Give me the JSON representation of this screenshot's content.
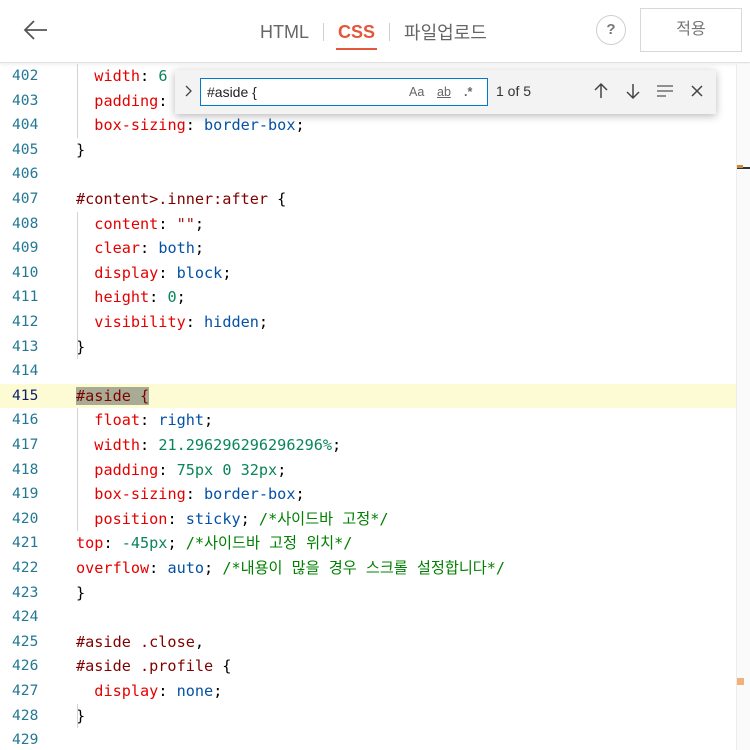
{
  "header": {
    "back_icon": "arrow-left-icon",
    "tabs": [
      {
        "label": "HTML",
        "active": false
      },
      {
        "label": "CSS",
        "active": true
      },
      {
        "label": "파일업로드",
        "active": false
      }
    ],
    "help_label": "?",
    "apply_label": "적용"
  },
  "find": {
    "toggle_icon": "chevron-right-icon",
    "query": "#aside {",
    "match_case_label": "Aa",
    "whole_word_label": "ab",
    "regex_label": ".*",
    "count": "1 of 5",
    "prev_icon": "arrow-up-icon",
    "next_icon": "arrow-down-icon",
    "in_selection_icon": "find-in-selection-icon",
    "close_icon": "close-icon"
  },
  "editor": {
    "current_line": "415",
    "lines": [
      {
        "num": "402",
        "tokens": [
          [
            "  ",
            "pun"
          ],
          [
            "width",
            "prop"
          ],
          [
            ": ",
            "pun"
          ],
          [
            "6",
            "num"
          ]
        ]
      },
      {
        "num": "403",
        "tokens": [
          [
            "  ",
            "pun"
          ],
          [
            "padding",
            "prop"
          ],
          [
            ":",
            "pun"
          ]
        ]
      },
      {
        "num": "404",
        "tokens": [
          [
            "  ",
            "pun"
          ],
          [
            "box-sizing",
            "prop"
          ],
          [
            ": ",
            "pun"
          ],
          [
            "border-box",
            "val"
          ],
          [
            ";",
            "pun"
          ]
        ]
      },
      {
        "num": "405",
        "tokens": [
          [
            "}",
            "pun"
          ]
        ]
      },
      {
        "num": "406",
        "tokens": []
      },
      {
        "num": "407",
        "tokens": [
          [
            "#content>.inner:after",
            "sel"
          ],
          [
            " {",
            "pun"
          ]
        ]
      },
      {
        "num": "408",
        "tokens": [
          [
            "  ",
            "pun"
          ],
          [
            "content",
            "prop"
          ],
          [
            ": ",
            "pun"
          ],
          [
            "\"\"",
            "str"
          ],
          [
            ";",
            "pun"
          ]
        ]
      },
      {
        "num": "409",
        "tokens": [
          [
            "  ",
            "pun"
          ],
          [
            "clear",
            "prop"
          ],
          [
            ": ",
            "pun"
          ],
          [
            "both",
            "val"
          ],
          [
            ";",
            "pun"
          ]
        ]
      },
      {
        "num": "410",
        "tokens": [
          [
            "  ",
            "pun"
          ],
          [
            "display",
            "prop"
          ],
          [
            ": ",
            "pun"
          ],
          [
            "block",
            "val"
          ],
          [
            ";",
            "pun"
          ]
        ]
      },
      {
        "num": "411",
        "tokens": [
          [
            "  ",
            "pun"
          ],
          [
            "height",
            "prop"
          ],
          [
            ": ",
            "pun"
          ],
          [
            "0",
            "num"
          ],
          [
            ";",
            "pun"
          ]
        ]
      },
      {
        "num": "412",
        "tokens": [
          [
            "  ",
            "pun"
          ],
          [
            "visibility",
            "prop"
          ],
          [
            ": ",
            "pun"
          ],
          [
            "hidden",
            "val"
          ],
          [
            ";",
            "pun"
          ]
        ]
      },
      {
        "num": "413",
        "tokens": [
          [
            "}",
            "pun"
          ]
        ]
      },
      {
        "num": "414",
        "tokens": []
      },
      {
        "num": "415",
        "tokens": [
          [
            "#aside {",
            "match"
          ]
        ]
      },
      {
        "num": "416",
        "tokens": [
          [
            "  ",
            "pun"
          ],
          [
            "float",
            "prop"
          ],
          [
            ": ",
            "pun"
          ],
          [
            "right",
            "val"
          ],
          [
            ";",
            "pun"
          ]
        ]
      },
      {
        "num": "417",
        "tokens": [
          [
            "  ",
            "pun"
          ],
          [
            "width",
            "prop"
          ],
          [
            ": ",
            "pun"
          ],
          [
            "21.296296296296296%",
            "num"
          ],
          [
            ";",
            "pun"
          ]
        ]
      },
      {
        "num": "418",
        "tokens": [
          [
            "  ",
            "pun"
          ],
          [
            "padding",
            "prop"
          ],
          [
            ": ",
            "pun"
          ],
          [
            "75px 0 32px",
            "num"
          ],
          [
            ";",
            "pun"
          ]
        ]
      },
      {
        "num": "419",
        "tokens": [
          [
            "  ",
            "pun"
          ],
          [
            "box-sizing",
            "prop"
          ],
          [
            ": ",
            "pun"
          ],
          [
            "border-box",
            "val"
          ],
          [
            ";",
            "pun"
          ]
        ]
      },
      {
        "num": "420",
        "tokens": [
          [
            "  ",
            "pun"
          ],
          [
            "position",
            "prop"
          ],
          [
            ": ",
            "pun"
          ],
          [
            "sticky",
            "val"
          ],
          [
            "; ",
            "pun"
          ],
          [
            "/*사이드바 고정*/",
            "com"
          ]
        ]
      },
      {
        "num": "421",
        "tokens": [
          [
            "top",
            "prop"
          ],
          [
            ": ",
            "pun"
          ],
          [
            "-45px",
            "num"
          ],
          [
            "; ",
            "pun"
          ],
          [
            "/*사이드바 고정 위치*/",
            "com"
          ]
        ]
      },
      {
        "num": "422",
        "tokens": [
          [
            "overflow",
            "prop"
          ],
          [
            ": ",
            "pun"
          ],
          [
            "auto",
            "val"
          ],
          [
            "; ",
            "pun"
          ],
          [
            "/*내용이 많을 경우 스크롤 설정합니다*/",
            "com"
          ]
        ]
      },
      {
        "num": "423",
        "tokens": [
          [
            "}",
            "pun"
          ]
        ]
      },
      {
        "num": "424",
        "tokens": []
      },
      {
        "num": "425",
        "tokens": [
          [
            "#aside .close",
            "sel"
          ],
          [
            ",",
            "pun"
          ]
        ]
      },
      {
        "num": "426",
        "tokens": [
          [
            "#aside .profile",
            "sel"
          ],
          [
            " {",
            "pun"
          ]
        ]
      },
      {
        "num": "427",
        "tokens": [
          [
            "  ",
            "pun"
          ],
          [
            "display",
            "prop"
          ],
          [
            ": ",
            "pun"
          ],
          [
            "none",
            "val"
          ],
          [
            ";",
            "pun"
          ]
        ]
      },
      {
        "num": "428",
        "tokens": [
          [
            "}",
            "pun"
          ]
        ]
      },
      {
        "num": "429",
        "tokens": []
      }
    ]
  },
  "colors": {
    "accent": "#e3573a",
    "line_number": "#237893",
    "current_line_bg": "#fdfbd4",
    "match_highlight": "#a8ac94",
    "find_border": "#007acc"
  }
}
